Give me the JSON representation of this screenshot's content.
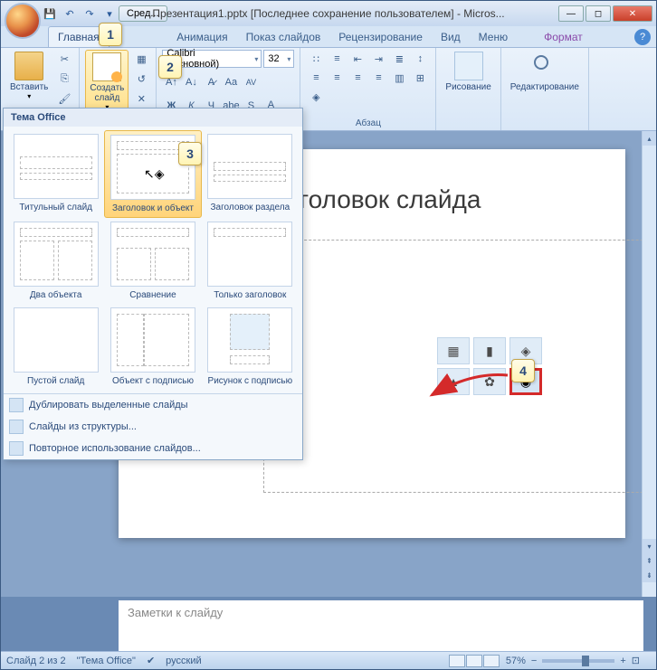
{
  "window": {
    "title": "Презентация1.pptx [Последнее сохранение пользователем] - Micros...",
    "tool_tip_btn": "Сред..."
  },
  "tabs": {
    "home": "Главная",
    "animation": "Анимация",
    "slideshow": "Показ слайдов",
    "review": "Рецензирование",
    "view": "Вид",
    "menu": "Меню",
    "format": "Формат"
  },
  "ribbon": {
    "paste": "Вставить",
    "new_slide": "Создать\nслайд",
    "font_name": "Calibri (Основной)",
    "font_size": "32",
    "group_paragraph": "Абзац",
    "drawing": "Рисование",
    "editing": "Редактирование"
  },
  "gallery": {
    "header": "Тема Office",
    "layouts": [
      "Титульный слайд",
      "Заголовок и объект",
      "Заголовок раздела",
      "Два объекта",
      "Сравнение",
      "Только заголовок",
      "Пустой слайд",
      "Объект с подписью",
      "Рисунок с подписью"
    ],
    "menu": {
      "duplicate": "Дублировать выделенные слайды",
      "outline": "Слайды из структуры...",
      "reuse": "Повторное использование слайдов..."
    }
  },
  "slide": {
    "title_text": "головок слайда",
    "notes_placeholder": "Заметки к слайду"
  },
  "statusbar": {
    "slide_count": "Слайд 2 из 2",
    "theme": "\"Тема Office\"",
    "language": "русский",
    "zoom": "57%"
  },
  "callouts": {
    "c1": "1",
    "c2": "2",
    "c3": "3",
    "c4": "4"
  }
}
